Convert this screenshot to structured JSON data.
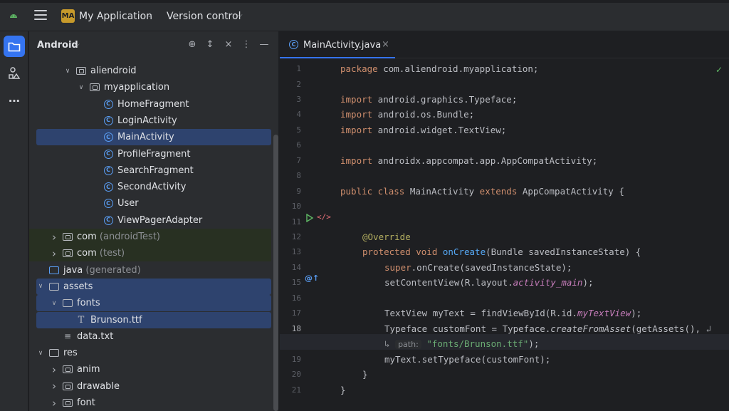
{
  "titlebar": {
    "project_badge": "MA",
    "project_name": "My Application",
    "version_control": "Version control"
  },
  "toolstrip": {
    "icons": [
      "folder-icon",
      "structure-icon",
      "more-icon"
    ]
  },
  "project_panel": {
    "title": "Android",
    "tree": [
      {
        "label": "aliendroid",
        "hint": "",
        "kind": "package",
        "depth": 1,
        "arrow": "open"
      },
      {
        "label": "myapplication",
        "hint": "",
        "kind": "package",
        "depth": 2,
        "arrow": "open"
      },
      {
        "label": "HomeFragment",
        "hint": "",
        "kind": "class",
        "depth": 3,
        "arrow": "none"
      },
      {
        "label": "LoginActivity",
        "hint": "",
        "kind": "class",
        "depth": 3,
        "arrow": "none"
      },
      {
        "label": "MainActivity",
        "hint": "",
        "kind": "class",
        "depth": 3,
        "arrow": "none",
        "selected": true
      },
      {
        "label": "ProfileFragment",
        "hint": "",
        "kind": "class",
        "depth": 3,
        "arrow": "none"
      },
      {
        "label": "SearchFragment",
        "hint": "",
        "kind": "class",
        "depth": 3,
        "arrow": "none"
      },
      {
        "label": "SecondActivity",
        "hint": "",
        "kind": "class",
        "depth": 3,
        "arrow": "none"
      },
      {
        "label": "User",
        "hint": "",
        "kind": "class",
        "depth": 3,
        "arrow": "none"
      },
      {
        "label": "ViewPagerAdapter",
        "hint": "",
        "kind": "class",
        "depth": 3,
        "arrow": "none"
      },
      {
        "label": "com",
        "hint": "(androidTest)",
        "kind": "package",
        "depth": 0,
        "arrow": "closed",
        "green": true
      },
      {
        "label": "com",
        "hint": "(test)",
        "kind": "package",
        "depth": 0,
        "arrow": "closed",
        "green": true
      },
      {
        "label": "java",
        "hint": "(generated)",
        "kind": "javagen",
        "depth": -1,
        "arrow": "none"
      },
      {
        "label": "assets",
        "hint": "",
        "kind": "folder",
        "depth": -1,
        "arrow": "open",
        "selected": true
      },
      {
        "label": "fonts",
        "hint": "",
        "kind": "folder",
        "depth": 0,
        "arrow": "open",
        "selected": true
      },
      {
        "label": "Brunson.ttf",
        "hint": "",
        "kind": "font",
        "depth": 1,
        "arrow": "none",
        "selected": true
      },
      {
        "label": "data.txt",
        "hint": "",
        "kind": "text",
        "depth": 0,
        "arrow": "none"
      },
      {
        "label": "res",
        "hint": "",
        "kind": "folder",
        "depth": -1,
        "arrow": "open"
      },
      {
        "label": "anim",
        "hint": "",
        "kind": "package",
        "depth": 0,
        "arrow": "closed"
      },
      {
        "label": "drawable",
        "hint": "",
        "kind": "package",
        "depth": 0,
        "arrow": "closed"
      },
      {
        "label": "font",
        "hint": "",
        "kind": "package",
        "depth": 0,
        "arrow": "closed"
      }
    ]
  },
  "editor": {
    "tab_label": "MainActivity.java",
    "tab_close": "×",
    "line_numbers": [
      "1",
      "2",
      "3",
      "4",
      "5",
      "6",
      "7",
      "8",
      "9",
      "10",
      "11",
      "12",
      "13",
      "14",
      "15",
      "16",
      "17",
      "18",
      "",
      "19",
      "20",
      "21"
    ],
    "current_line": "18",
    "code": {
      "l1_kw": "package",
      "l1_rest": " com.aliendroid.myapplication;",
      "l3_kw": "import",
      "l3_rest": " android.graphics.Typeface;",
      "l4_kw": "import",
      "l4_rest": " android.os.Bundle;",
      "l5_kw": "import",
      "l5_rest": " android.widget.TextView;",
      "l7_kw": "import",
      "l7_rest": " androidx.appcompat.app.AppCompatActivity;",
      "l9_kw1": "public class",
      "l9_name": " MainActivity ",
      "l9_kw2": "extends",
      "l9_rest": " AppCompatActivity {",
      "l12_ann": "@Override",
      "l13_kw": "protected void",
      "l13_fn": " onCreate",
      "l13_rest": "(Bundle savedInstanceState) {",
      "l14_kw": "super",
      "l14_rest": ".onCreate(savedInstanceState);",
      "l15_pre": "setContentView(R.layout.",
      "l15_it": "activity_main",
      "l15_post": ");",
      "l17_pre": "TextView myText = findViewById(R.id.",
      "l17_it": "myTextView",
      "l17_post": ");",
      "l18_pre": "Typeface customFont = Typeface.",
      "l18_itn": "createFromAsset",
      "l18_post": "(getAssets(), ",
      "l18b_hint": "path:",
      "l18b_str": "\"fonts/Brunson.ttf\"",
      "l18b_post": ");",
      "l19": "myText.setTypeface(customFont);",
      "l20": "}",
      "l21": "}"
    }
  }
}
